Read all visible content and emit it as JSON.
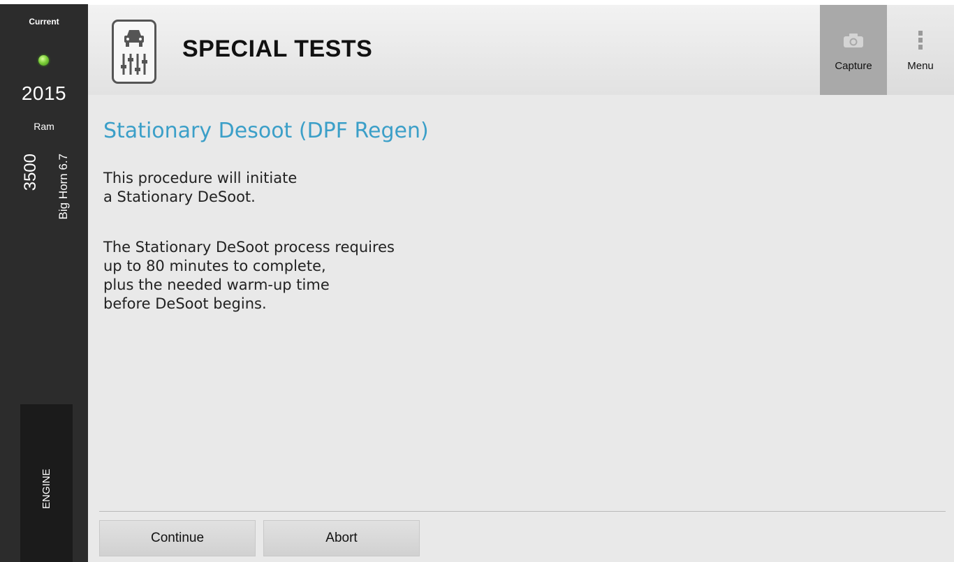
{
  "vehicle": {
    "status_label": "Current",
    "status_color": "#6ccf33",
    "year": "2015",
    "make": "Ram",
    "model": "3500",
    "trim": "Big Horn 6.7",
    "module": "ENGINE"
  },
  "header": {
    "icon": "vehicle-diagnostic-icon",
    "title": "SPECIAL TESTS",
    "capture_label": "Capture",
    "capture_icon": "camera-icon",
    "menu_label": "Menu",
    "menu_icon": "kebab-menu-icon"
  },
  "procedure": {
    "title": "Stationary Desoot (DPF Regen)",
    "title_color": "#3b9fc8",
    "paragraph1": "This procedure will initiate\na Stationary DeSoot.",
    "paragraph2": "The Stationary DeSoot process requires\nup to 80 minutes to complete,\nplus the needed warm-up time\nbefore DeSoot begins."
  },
  "actions": {
    "continue_label": "Continue",
    "abort_label": "Abort"
  }
}
